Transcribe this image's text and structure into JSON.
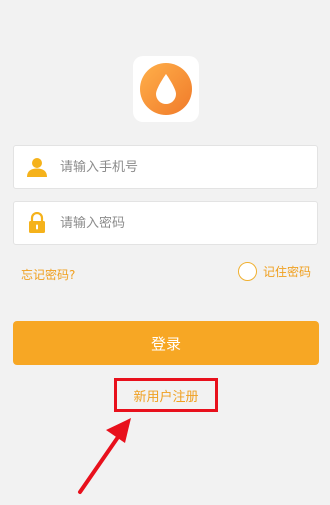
{
  "phone_field": {
    "placeholder": "请输入手机号"
  },
  "password_field": {
    "placeholder": "请输入密码"
  },
  "forgot_password": "忘记密码?",
  "remember_password": "记住密码",
  "login_button": "登录",
  "register_link": "新用户注册",
  "colors": {
    "accent": "#f7a724",
    "annotation": "#e8101c"
  }
}
